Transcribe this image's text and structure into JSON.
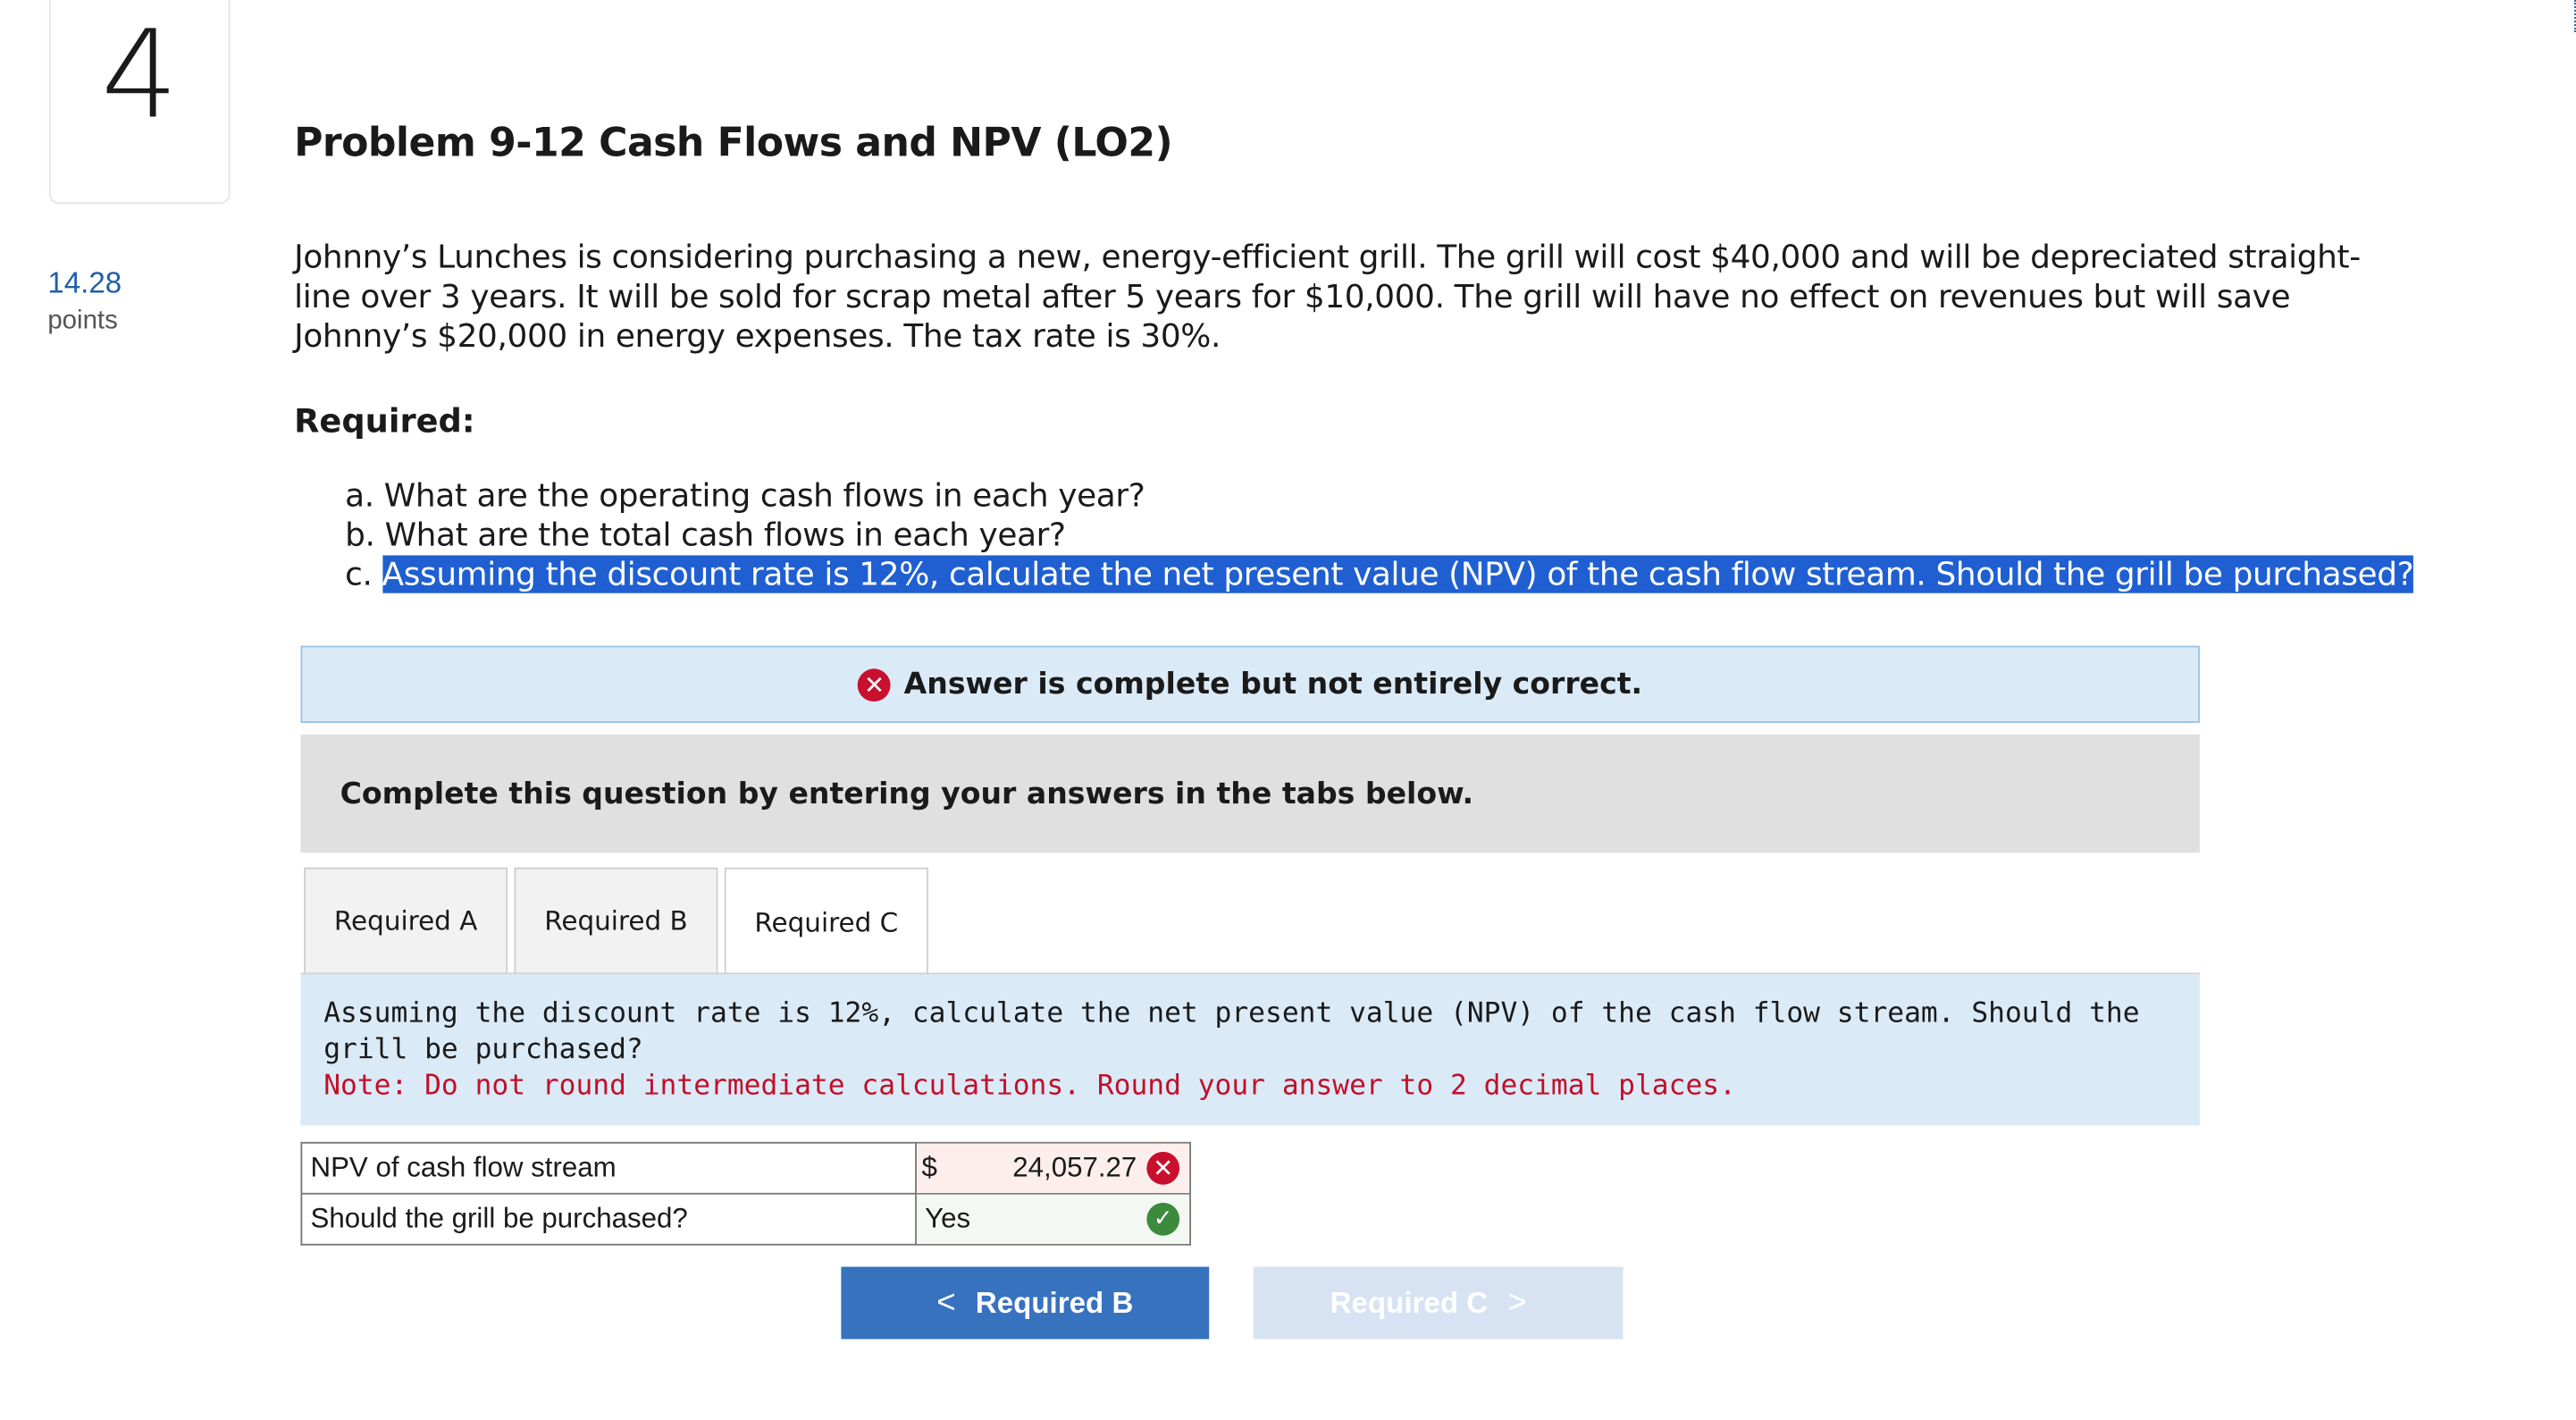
{
  "question": {
    "number": "4",
    "points_value": "14.28",
    "points_label": "points",
    "title": "Problem 9-12 Cash Flows and NPV (LO2)",
    "prompt": "Johnny’s Lunches is considering purchasing a new, energy-efficient grill. The grill will cost $40,000 and will be depreciated straight-line over 3 years. It will be sold for scrap metal after 5 years for $10,000. The grill will have no effect on revenues but will save Johnny’s $20,000 in energy expenses. The tax rate is 30%.",
    "required_label": "Required:",
    "requirements": [
      {
        "prefix": "a.",
        "text": "What are the operating cash flows in each year?"
      },
      {
        "prefix": "b.",
        "text": "What are the total cash flows in each year?"
      },
      {
        "prefix": "c.",
        "text": "Assuming the discount rate is 12%, calculate the net present value (NPV) of the cash flow stream. Should the grill be purchased?"
      }
    ]
  },
  "status": {
    "icon": "x-circle-icon",
    "message": "Answer is complete but not entirely correct."
  },
  "instructions": "Complete this question by entering your answers in the tabs below.",
  "tabs": [
    {
      "label": "Required A"
    },
    {
      "label": "Required B"
    },
    {
      "label": "Required C"
    }
  ],
  "active_tab": "Required C",
  "panel": {
    "question": "Assuming the discount rate is 12%, calculate the net present value (NPV) of the cash flow stream. Should the grill be purchased?",
    "note": "Note: Do not round intermediate calculations. Round your answer to 2 decimal places."
  },
  "answers": [
    {
      "label": "NPV of cash flow stream",
      "currency": "$",
      "value": "24,057.27",
      "result": "incorrect"
    },
    {
      "label": "Should the grill be purchased?",
      "currency": "",
      "value": "Yes",
      "result": "correct"
    }
  ],
  "nav": {
    "prev_label": "Required B",
    "next_label": "Required C"
  },
  "colors": {
    "link_blue": "#1f5fa8",
    "highlight": "#1f5fd1",
    "error_red": "#c8102e",
    "success_green": "#3b8a3e",
    "panel_blue": "#dbeaf7",
    "button_blue": "#3772bf"
  }
}
